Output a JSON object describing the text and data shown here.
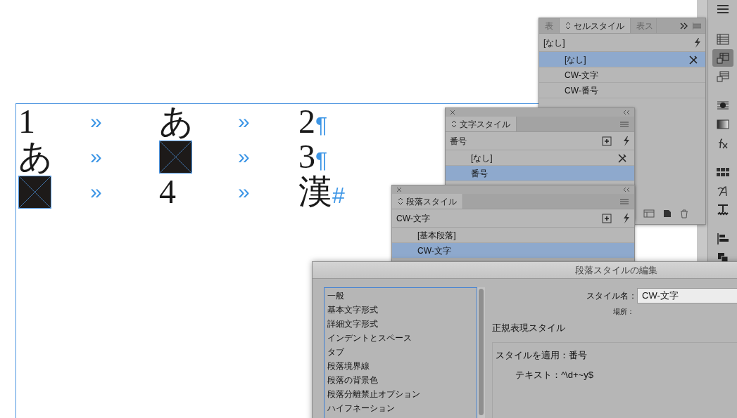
{
  "document": {
    "rows": [
      [
        {
          "kind": "char",
          "text": "1"
        },
        {
          "kind": "tab",
          "text": "»"
        },
        {
          "kind": "char",
          "text": "あ"
        },
        {
          "kind": "tab",
          "text": "»"
        },
        {
          "kind": "char",
          "text": "2",
          "end": "¶"
        }
      ],
      [
        {
          "kind": "char",
          "text": "あ"
        },
        {
          "kind": "tab",
          "text": "»"
        },
        {
          "kind": "frame"
        },
        {
          "kind": "tab",
          "text": "»"
        },
        {
          "kind": "char",
          "text": "3",
          "end": "¶"
        }
      ],
      [
        {
          "kind": "frame"
        },
        {
          "kind": "tab",
          "text": "»"
        },
        {
          "kind": "char",
          "text": "4"
        },
        {
          "kind": "tab",
          "text": "»"
        },
        {
          "kind": "char",
          "text": "漢",
          "end": "#"
        }
      ]
    ]
  },
  "cell_style_panel": {
    "tabs": [
      {
        "label": "表",
        "selected": false
      },
      {
        "label": "セルスタイル",
        "selected": true
      },
      {
        "label": "表ス",
        "selected": false
      }
    ],
    "current": "[なし]",
    "items": [
      {
        "label": "[なし]",
        "selected": true,
        "locked": true
      },
      {
        "label": "CW-文字",
        "selected": false,
        "locked": false
      },
      {
        "label": "CW-番号",
        "selected": false,
        "locked": false
      }
    ]
  },
  "character_style_panel": {
    "tab": "文字スタイル",
    "current": "番号",
    "items": [
      {
        "label": "[なし]",
        "selected": false,
        "locked": true
      },
      {
        "label": "番号",
        "selected": true,
        "locked": false
      }
    ]
  },
  "paragraph_style_panel": {
    "tab": "段落スタイル",
    "current": "CW-文字",
    "items": [
      {
        "label": "[基本段落]",
        "selected": false,
        "locked": false
      },
      {
        "label": "CW-文字",
        "selected": true,
        "locked": false
      }
    ]
  },
  "dialog": {
    "title": "段落スタイルの編集",
    "categories": [
      "一般",
      "基本文字形式",
      "詳細文字形式",
      "インデントとスペース",
      "タブ",
      "段落境界線",
      "段落の背景色",
      "段落分離禁止オプション",
      "ハイフネーション"
    ],
    "style_name_label": "スタイル名：",
    "style_name": "CW-文字",
    "location_label": "場所：",
    "section_title": "正規表現スタイル",
    "rules": [
      {
        "kind": "apply",
        "text": "スタイルを適用：番号"
      },
      {
        "kind": "pattern",
        "text": "テキスト：^\\d+~y$"
      }
    ]
  },
  "toolbar": [
    {
      "kind": "menu",
      "selected": false
    },
    {
      "kind": "table",
      "selected": false
    },
    {
      "kind": "cell-style",
      "selected": true
    },
    {
      "kind": "table-style",
      "selected": false
    },
    {
      "kind": "stroke",
      "selected": false
    },
    {
      "kind": "gradient",
      "selected": false
    },
    {
      "kind": "effects",
      "selected": false
    },
    {
      "kind": "swatch-grid",
      "selected": false
    },
    {
      "kind": "glyph",
      "selected": false
    },
    {
      "kind": "text-wrap",
      "selected": false
    },
    {
      "kind": "align",
      "selected": false
    },
    {
      "kind": "pathfinder",
      "selected": false
    }
  ]
}
